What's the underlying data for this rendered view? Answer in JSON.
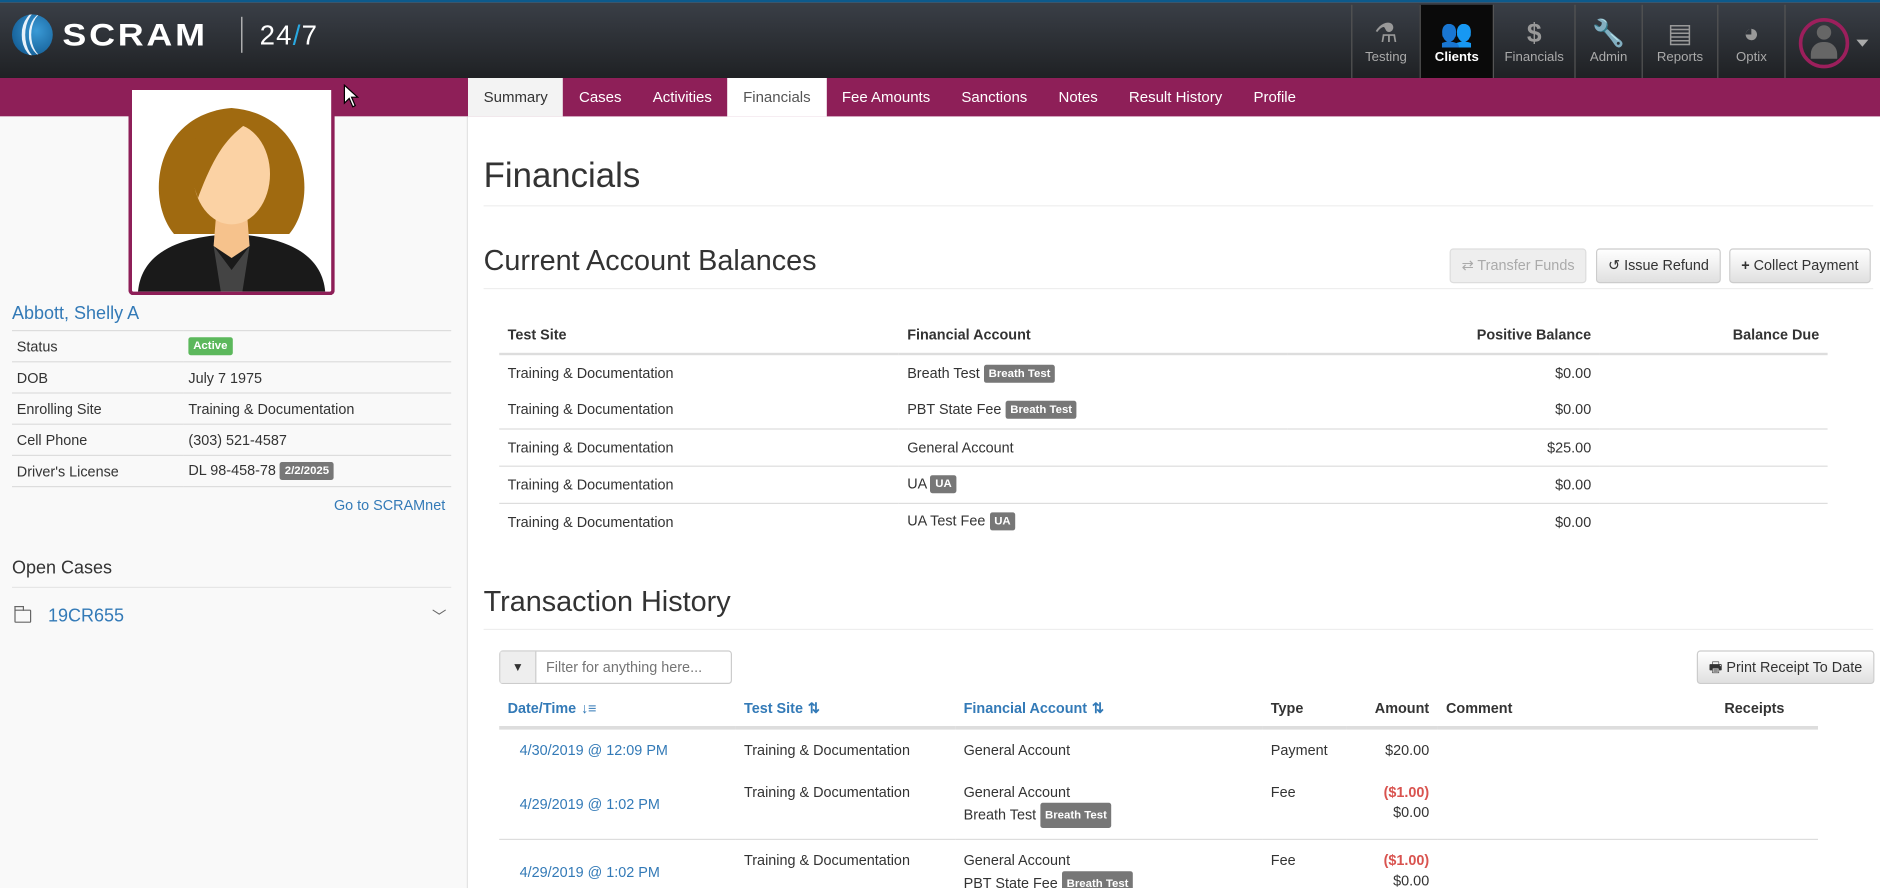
{
  "header": {
    "brand": "SCRAM",
    "product_a": "24",
    "product_slash": "/",
    "product_b": "7",
    "nav": [
      {
        "label": "Testing",
        "icon": "flask-icon"
      },
      {
        "label": "Clients",
        "icon": "users-icon",
        "active": true
      },
      {
        "label": "Financials",
        "icon": "dollar-icon"
      },
      {
        "label": "Admin",
        "icon": "wrench-icon"
      },
      {
        "label": "Reports",
        "icon": "document-icon"
      },
      {
        "label": "Optix",
        "icon": "dashboard-icon"
      }
    ]
  },
  "tabs": [
    "Summary",
    "Cases",
    "Activities",
    "Financials",
    "Fee Amounts",
    "Sanctions",
    "Notes",
    "Result History",
    "Profile"
  ],
  "client": {
    "name": "Abbott, Shelly A",
    "fields": [
      {
        "label": "Status",
        "value": "",
        "badge": "Active"
      },
      {
        "label": "DOB",
        "value": "July 7 1975"
      },
      {
        "label": "Enrolling Site",
        "value": "Training & Documentation"
      },
      {
        "label": "Cell Phone",
        "value": "(303) 521-4587"
      },
      {
        "label": "Driver's License",
        "value": "DL 98-458-78",
        "badge": "2/2/2025"
      }
    ],
    "scramnet_link": "Go to SCRAMnet",
    "open_cases_title": "Open Cases",
    "cases": [
      "19CR655"
    ]
  },
  "page_title": "Financials",
  "balances": {
    "title": "Current Account Balances",
    "buttons": {
      "transfer": "Transfer Funds",
      "refund": "Issue Refund",
      "collect": "Collect Payment"
    },
    "columns": [
      "Test Site",
      "Financial Account",
      "Positive Balance",
      "Balance Due"
    ],
    "rows": [
      {
        "site": "Training & Documentation",
        "account": "Breath Test",
        "tag": "Breath Test",
        "positive": "$0.00",
        "due": ""
      },
      {
        "site": "Training & Documentation",
        "account": "PBT State Fee",
        "tag": "Breath Test",
        "positive": "$0.00",
        "due": ""
      },
      {
        "site": "Training & Documentation",
        "account": "General Account",
        "tag": "",
        "positive": "$25.00",
        "due": ""
      },
      {
        "site": "Training & Documentation",
        "account": "UA",
        "tag": "UA",
        "positive": "$0.00",
        "due": ""
      },
      {
        "site": "Training & Documentation",
        "account": "UA Test Fee",
        "tag": "UA",
        "positive": "$0.00",
        "due": ""
      }
    ]
  },
  "transactions": {
    "title": "Transaction History",
    "filter_placeholder": "Filter for anything here...",
    "print_button": "Print Receipt To Date",
    "columns": [
      "Date/Time",
      "Test Site",
      "Financial Account",
      "Type",
      "Amount",
      "Comment",
      "Receipts"
    ],
    "rows": [
      {
        "date": "4/30/2019 @ 12:09 PM",
        "site": "Training & Documentation",
        "account1": "General Account",
        "account2": "",
        "tag": "",
        "type": "Payment",
        "amount1": "$20.00",
        "amount2": ""
      },
      {
        "date": "4/29/2019 @ 1:02 PM",
        "site": "Training & Documentation",
        "account1": "General Account",
        "account2": "Breath Test",
        "tag": "Breath Test",
        "type": "Fee",
        "amount1": "($1.00)",
        "amount2": "$0.00"
      },
      {
        "date": "4/29/2019 @ 1:02 PM",
        "site": "Training & Documentation",
        "account1": "General Account",
        "account2": "PBT State Fee",
        "tag": "Breath Test",
        "type": "Fee",
        "amount1": "($1.00)",
        "amount2": "$0.00"
      }
    ]
  }
}
